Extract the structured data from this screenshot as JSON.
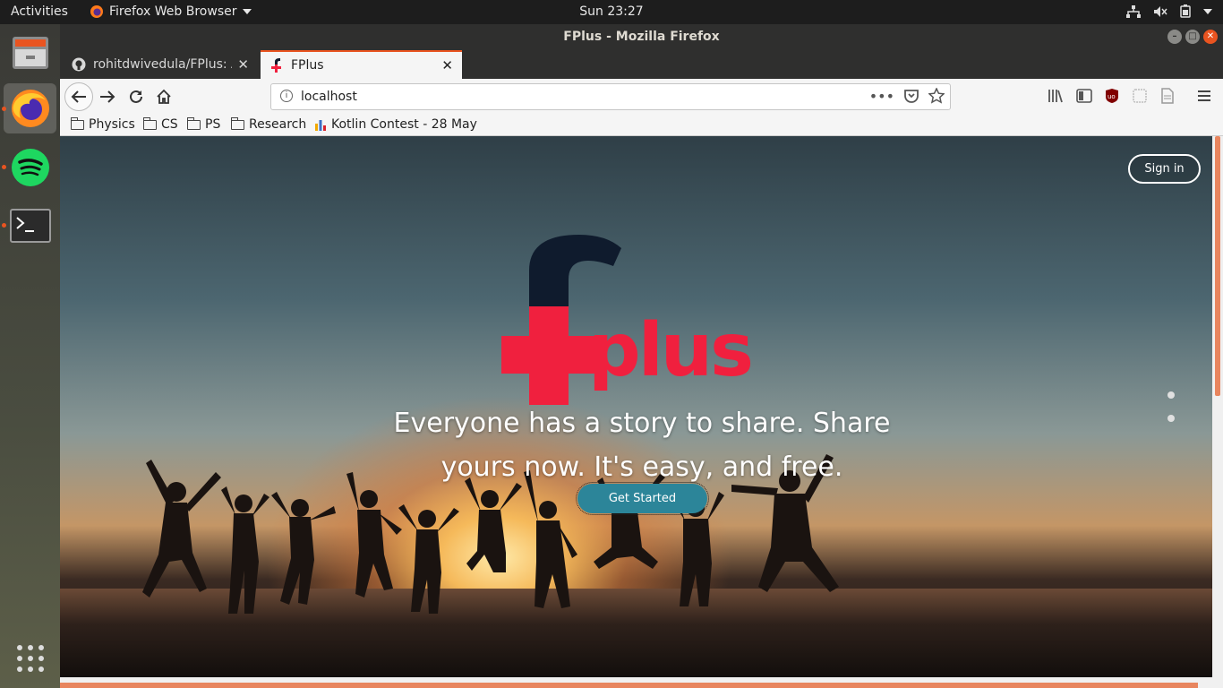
{
  "topbar": {
    "activities": "Activities",
    "app_menu": "Firefox Web Browser",
    "clock": "Sun 23:27"
  },
  "dock": {
    "items": [
      "files-app",
      "firefox",
      "spotify",
      "terminal",
      "show-applications"
    ]
  },
  "window": {
    "title": "FPlus - Mozilla Firefox"
  },
  "tabs": [
    {
      "label": "rohitdwivedula/FPlus: A"
    },
    {
      "label": "FPlus"
    }
  ],
  "urlbar": {
    "url": "localhost"
  },
  "bookmarks": [
    {
      "label": "Physics"
    },
    {
      "label": "CS"
    },
    {
      "label": "PS"
    },
    {
      "label": "Research"
    },
    {
      "label": "Kotlin Contest - 28 May"
    }
  ],
  "page": {
    "signin": "Sign in",
    "logo_text": "plus",
    "tagline": "Everyone has a story to share. Share yours now. It's easy, and free.",
    "cta": "Get Started"
  },
  "colors": {
    "brand_red": "#f0203e",
    "brand_navy": "#0f1b2d",
    "cta_teal": "#2c8599",
    "accent_orange": "#e95420"
  }
}
